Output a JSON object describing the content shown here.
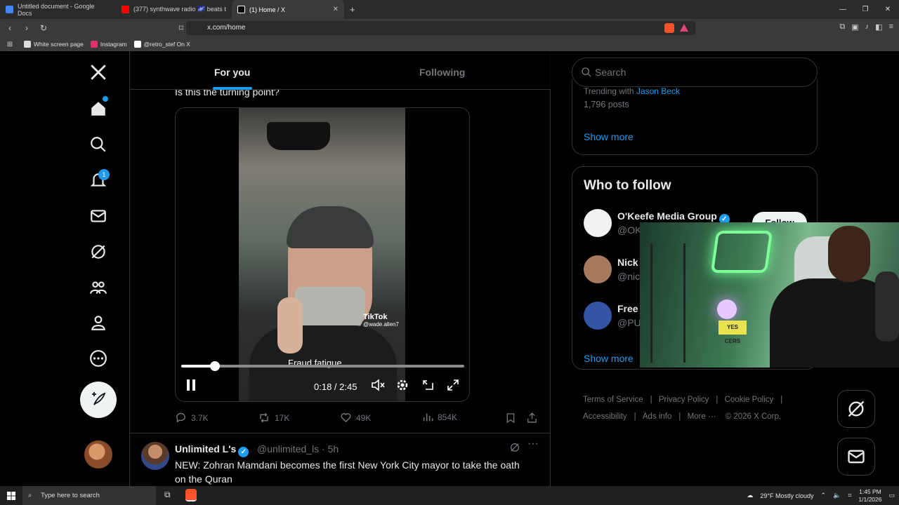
{
  "browser": {
    "tabs": [
      {
        "title": "Untitled document - Google Docs",
        "favicon_color": "#4285f4"
      },
      {
        "title": "(377) synthwave radio 🌌 beats t",
        "favicon_color": "#ff0000"
      },
      {
        "title": "(1) Home / X",
        "favicon_color": "#ffffff",
        "active": true
      }
    ],
    "new_tab": "+",
    "url": "x.com/home",
    "window_controls": [
      "—",
      "❐",
      "✕"
    ],
    "bookmarks": [
      {
        "label": "White screen page",
        "color": "#dddddd"
      },
      {
        "label": "Instagram",
        "color": "#e1306c"
      },
      {
        "label": "@retro_stef On X",
        "color": "#ffffff"
      }
    ]
  },
  "x": {
    "leftnav": {
      "notifications_badge": "1",
      "items": [
        "home-icon",
        "search-icon",
        "bell-icon",
        "mail-icon",
        "grok-icon",
        "communities-icon",
        "profile-icon",
        "more-icon"
      ]
    },
    "feed": {
      "tabs": {
        "for_you": "For you",
        "following": "Following"
      },
      "post_text_partial": "Is this the turning point?",
      "video": {
        "watermark": "TikTok",
        "watermark_handle": "@wade.allen7",
        "caption": "Fraud fatigue.",
        "time": "0:18 / 2:45",
        "progress": 0.12
      },
      "actions": {
        "replies": "3.7K",
        "reposts": "17K",
        "likes": "49K",
        "views": "854K"
      },
      "next_post": {
        "name": "Unlimited L's",
        "handle": "@unlimited_ls · 5h",
        "text": "NEW: Zohran Mamdani becomes the first New York City mayor to take the oath on the Quran"
      }
    },
    "sidebar": {
      "search_placeholder": "Search",
      "trend": {
        "context_prefix": "Trending with",
        "context_link": "Jason Beck",
        "posts": "1,796 posts"
      },
      "show_more": "Show more",
      "who_to_follow": {
        "title": "Who to follow",
        "accounts": [
          {
            "name": "O'Keefe Media Group",
            "handle": "@OK",
            "avatar_color": "#f2f2f2"
          },
          {
            "name": "Nick",
            "handle": "@nic",
            "avatar_color": "#a87a5c"
          },
          {
            "name": "Free",
            "handle": "@PU",
            "avatar_color": "#3455a4"
          }
        ],
        "follow_label": "Follow",
        "show_more": "Show more"
      },
      "footer": {
        "links": [
          "Terms of Service",
          "Privacy Policy",
          "Cookie Policy",
          "Accessibility",
          "Ads info",
          "More ···"
        ],
        "copyright": "© 2026 X Corp."
      }
    }
  },
  "webcam": {
    "sign": "YES CERS"
  },
  "taskbar": {
    "search_placeholder": "Type here to search",
    "weather": "29°F  Mostly cloudy",
    "time": "1:45 PM",
    "date": "1/1/2026"
  }
}
